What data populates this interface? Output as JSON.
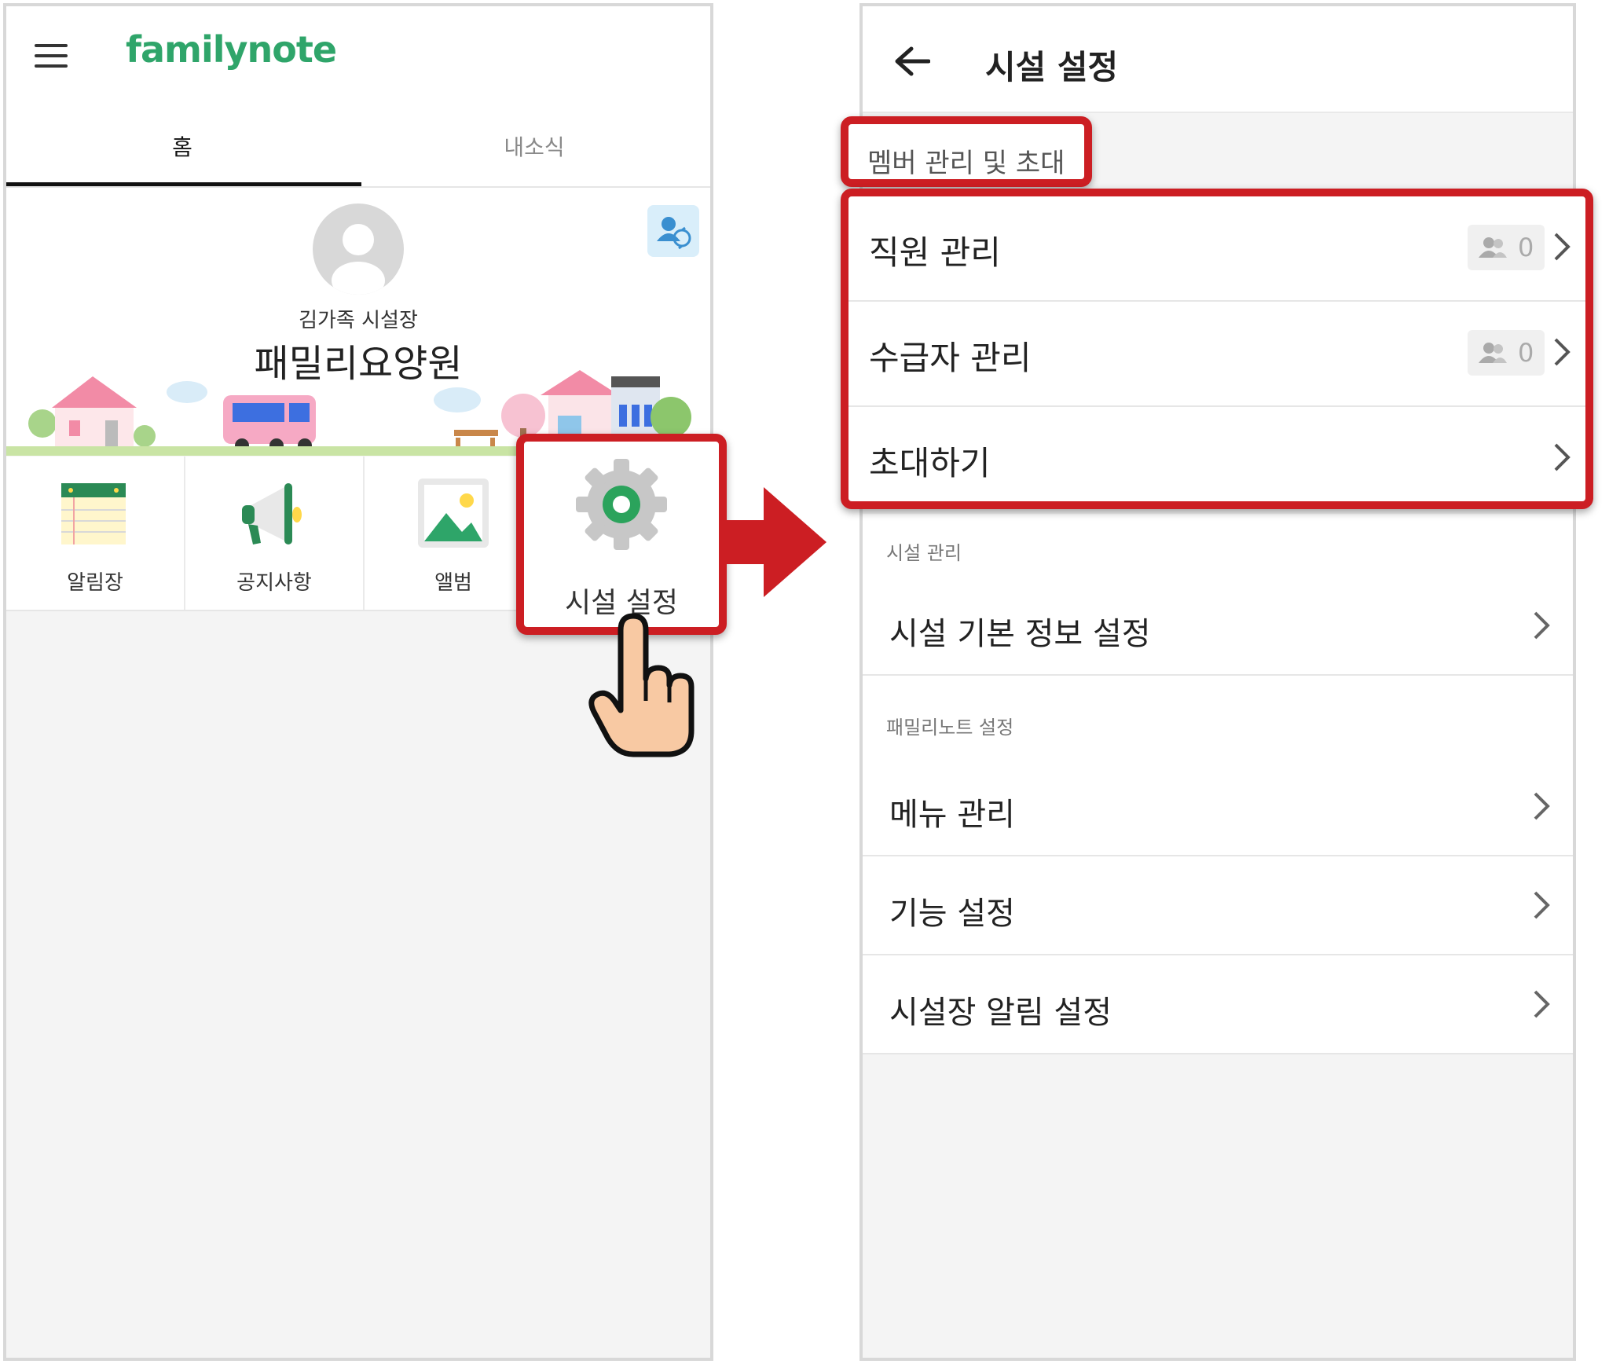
{
  "left": {
    "logo": "familynote",
    "tabs": [
      {
        "label": "홈"
      },
      {
        "label": "내소식"
      }
    ],
    "profile": {
      "role": "김가족 시설장",
      "facility": "패밀리요양원"
    },
    "menu": [
      {
        "label": "알림장"
      },
      {
        "label": "공지사항"
      },
      {
        "label": "앨범"
      },
      {
        "label": "시설 설정"
      }
    ]
  },
  "right": {
    "title": "시설 설정",
    "sections": [
      {
        "header": "멤버 관리 및 초대",
        "items": [
          {
            "label": "직원 관리",
            "count": "0"
          },
          {
            "label": "수급자 관리",
            "count": "0"
          },
          {
            "label": "초대하기"
          }
        ]
      },
      {
        "header": "시설 관리",
        "items": [
          {
            "label": "시설 기본 정보 설정"
          }
        ]
      },
      {
        "header": "패밀리노트 설정",
        "items": [
          {
            "label": "메뉴 관리"
          },
          {
            "label": "기능 설정"
          },
          {
            "label": "시설장 알림 설정"
          }
        ]
      }
    ]
  },
  "colors": {
    "brand": "#2fa56a",
    "highlight": "#cc1e23",
    "arrow": "#cc1e23"
  }
}
